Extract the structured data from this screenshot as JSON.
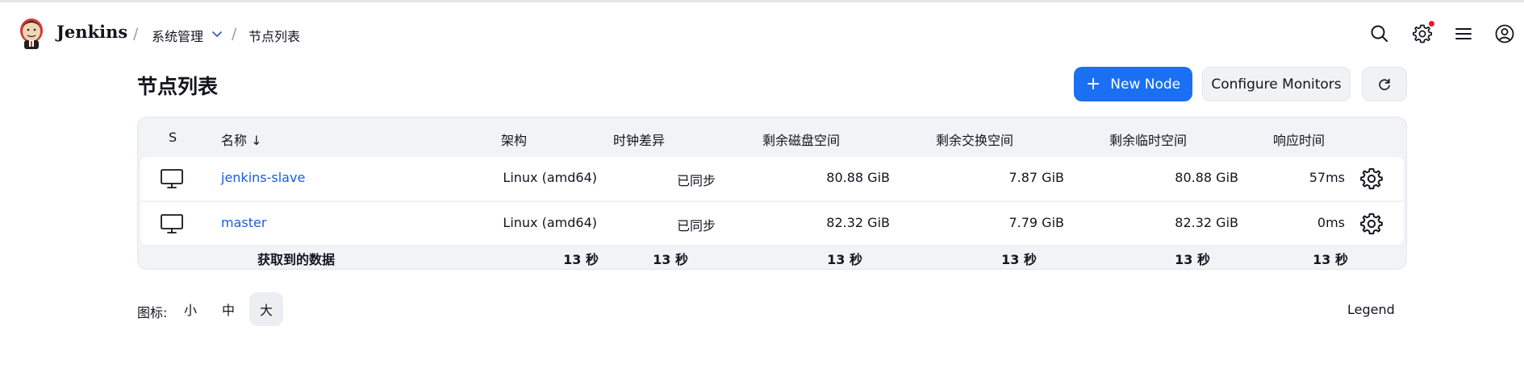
{
  "header": {
    "brand": "Jenkins",
    "breadcrumbs": [
      "系统管理",
      "节点列表"
    ],
    "icons": [
      "search-icon",
      "settings-icon",
      "menu-icon",
      "account-icon"
    ],
    "notification_color": "#e5182d"
  },
  "page": {
    "title": "节点列表",
    "new_node_label": "New Node",
    "configure_monitors_label": "Configure Monitors",
    "accent_color": "#1a6ff2"
  },
  "table": {
    "headers": {
      "status": "S",
      "name": "名称 ↓",
      "arch": "架构",
      "clock": "时钟差异",
      "disk": "剩余磁盘空间",
      "swap": "剩余交换空间",
      "temp": "剩余临时空间",
      "response": "响应时间"
    },
    "rows": [
      {
        "name": "jenkins-slave",
        "arch": "Linux (amd64)",
        "clock": "已同步",
        "disk": "80.88 GiB",
        "swap": "7.87 GiB",
        "temp": "80.88 GiB",
        "response": "57ms"
      },
      {
        "name": "master",
        "arch": "Linux (amd64)",
        "clock": "已同步",
        "disk": "82.32 GiB",
        "swap": "7.79 GiB",
        "temp": "82.32 GiB",
        "response": "0ms"
      }
    ],
    "footer": {
      "label": "获取到的数据",
      "arch": "13 秒",
      "clock": "13 秒",
      "disk": "13 秒",
      "swap": "13 秒",
      "temp": "13 秒",
      "response": "13 秒"
    }
  },
  "icon_size": {
    "label": "图标:",
    "options": [
      "小",
      "中",
      "大"
    ],
    "selected": "大"
  },
  "legend_label": "Legend"
}
